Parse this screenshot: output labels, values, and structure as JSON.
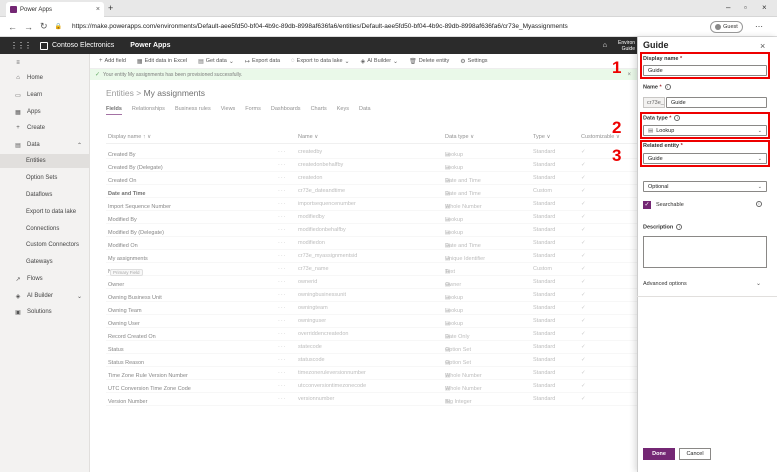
{
  "browser": {
    "tab_title": "Power Apps",
    "url": "https://make.powerapps.com/environments/Default-aee5fd50-bf04-4b9c-89db-8998af636fa6/entities/Default-aee5fd50-bf04-4b9c-89db-8998af636fa6/cr73e_Myassignments",
    "guest_label": "Guest"
  },
  "header": {
    "brand": "Contoso Electronics",
    "product": "Power Apps",
    "env_line1": "Environ",
    "env_line2": "Guide"
  },
  "nav": {
    "items": [
      {
        "label": "Home",
        "icon": "home-icon"
      },
      {
        "label": "Learn",
        "icon": "book-icon"
      },
      {
        "label": "Apps",
        "icon": "apps-icon"
      },
      {
        "label": "Create",
        "icon": "plus-icon"
      },
      {
        "label": "Data",
        "icon": "database-icon"
      },
      {
        "label": "Entities"
      },
      {
        "label": "Option Sets"
      },
      {
        "label": "Dataflows"
      },
      {
        "label": "Export to data lake"
      },
      {
        "label": "Connections"
      },
      {
        "label": "Custom Connectors"
      },
      {
        "label": "Gateways"
      },
      {
        "label": "Flows",
        "icon": "flow-icon"
      },
      {
        "label": "AI Builder",
        "icon": "ai-icon"
      },
      {
        "label": "Solutions",
        "icon": "solutions-icon"
      }
    ]
  },
  "commandbar": {
    "add_field": "Add field",
    "edit_excel": "Edit data in Excel",
    "get_data": "Get data",
    "export_data": "Export data",
    "export_lake": "Export to data lake",
    "ai_builder": "AI Builder",
    "delete_entity": "Delete entity",
    "settings": "Settings"
  },
  "banner": {
    "text": "Your entity My assignments has been provisioned successfully."
  },
  "breadcrumb": {
    "root": "Entities",
    "sep": ">",
    "current": "My assignments"
  },
  "tabs": [
    "Fields",
    "Relationships",
    "Business rules",
    "Views",
    "Forms",
    "Dashboards",
    "Charts",
    "Keys",
    "Data"
  ],
  "table": {
    "headers": {
      "display": "Display name ↑ ∨",
      "name": "Name ∨",
      "type": "Data type ∨",
      "kind": "Type ∨",
      "custom": "Customizable ∨"
    },
    "rows": [
      {
        "display": "Created By",
        "name": "createdby",
        "type": "Lookup",
        "kind": "Standard",
        "bold": false
      },
      {
        "display": "Created By (Delegate)",
        "name": "createdonbehalfby",
        "type": "Lookup",
        "kind": "Standard",
        "bold": false
      },
      {
        "display": "Created On",
        "name": "createdon",
        "type": "Date and Time",
        "kind": "Standard",
        "bold": false
      },
      {
        "display": "Date and Time",
        "name": "cr73e_dateandtime",
        "type": "Date and Time",
        "kind": "Custom",
        "bold": true
      },
      {
        "display": "Import Sequence Number",
        "name": "importsequencenumber",
        "type": "Whole Number",
        "kind": "Standard",
        "bold": false
      },
      {
        "display": "Modified By",
        "name": "modifiedby",
        "type": "Lookup",
        "kind": "Standard",
        "bold": false
      },
      {
        "display": "Modified By (Delegate)",
        "name": "modifiedonbehalfby",
        "type": "Lookup",
        "kind": "Standard",
        "bold": false
      },
      {
        "display": "Modified On",
        "name": "modifiedon",
        "type": "Date and Time",
        "kind": "Standard",
        "bold": false
      },
      {
        "display": "My assignments",
        "name": "cr73e_myassignmentsid",
        "type": "Unique Identifier",
        "kind": "Standard",
        "bold": false
      },
      {
        "display": "Name",
        "pill": "Primary Field",
        "name": "cr73e_name",
        "type": "Text",
        "kind": "Custom",
        "bold": false
      },
      {
        "display": "Owner",
        "name": "ownerid",
        "type": "Owner",
        "kind": "Standard",
        "bold": false
      },
      {
        "display": "Owning Business Unit",
        "name": "owningbusinessunit",
        "type": "Lookup",
        "kind": "Standard",
        "bold": false
      },
      {
        "display": "Owning Team",
        "name": "owningteam",
        "type": "Lookup",
        "kind": "Standard",
        "bold": false
      },
      {
        "display": "Owning User",
        "name": "owninguser",
        "type": "Lookup",
        "kind": "Standard",
        "bold": false
      },
      {
        "display": "Record Created On",
        "name": "overriddencreatedon",
        "type": "Date Only",
        "kind": "Standard",
        "bold": false
      },
      {
        "display": "Status",
        "name": "statecode",
        "type": "Option Set",
        "kind": "Standard",
        "bold": false
      },
      {
        "display": "Status Reason",
        "name": "statuscode",
        "type": "Option Set",
        "kind": "Standard",
        "bold": false
      },
      {
        "display": "Time Zone Rule Version Number",
        "name": "timezoneruleversionnumber",
        "type": "Whole Number",
        "kind": "Standard",
        "bold": false
      },
      {
        "display": "UTC Conversion Time Zone Code",
        "name": "utcconversiontimezonecode",
        "type": "Whole Number",
        "kind": "Standard",
        "bold": false
      },
      {
        "display": "Version Number",
        "name": "versionnumber",
        "type": "Big Integer",
        "kind": "Standard",
        "bold": false
      }
    ]
  },
  "panel": {
    "title": "Guide",
    "display_name_label": "Display name",
    "display_name_value": "Guide",
    "name_label": "Name",
    "name_prefix": "cr73e_",
    "name_value": "Guide",
    "data_type_label": "Data type",
    "data_type_value": "Lookup",
    "related_entity_label": "Related entity",
    "related_entity_value": "Guide",
    "required_value": "Optional",
    "searchable_label": "Searchable",
    "description_label": "Description",
    "advanced_label": "Advanced options",
    "done_label": "Done",
    "cancel_label": "Cancel",
    "callouts": [
      "1",
      "2",
      "3"
    ],
    "callout_color": "#e00000"
  },
  "colors": {
    "accent": "#742774",
    "success": "#107c10"
  }
}
